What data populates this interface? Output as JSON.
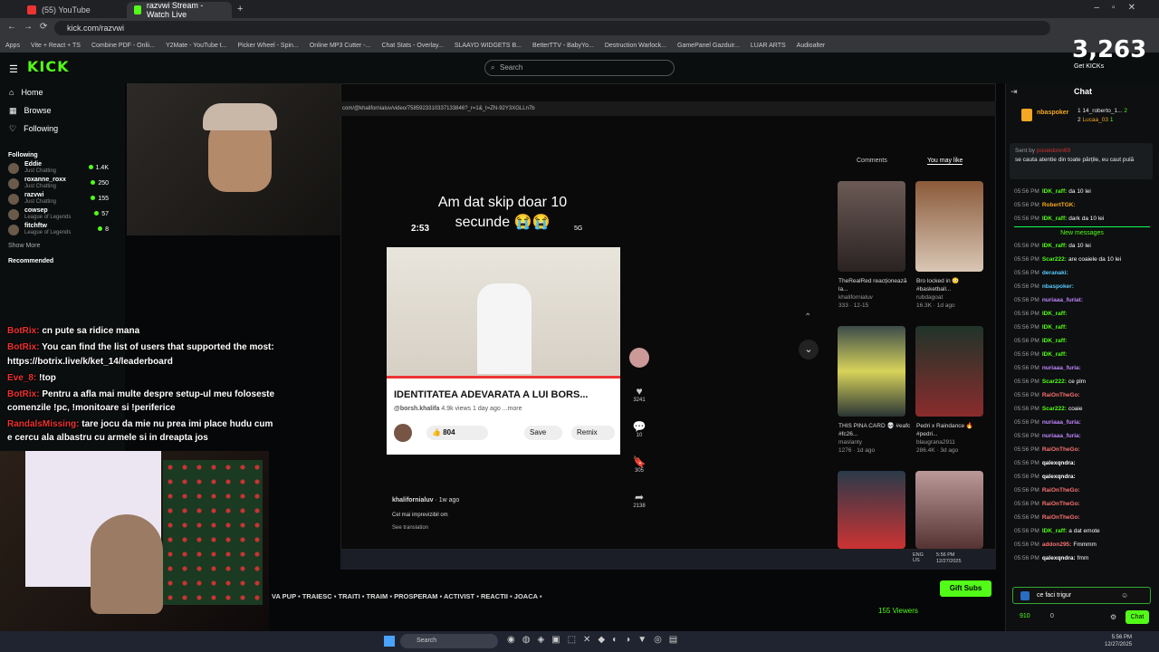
{
  "browser": {
    "tabs": [
      {
        "label": "(55) YouTube"
      },
      {
        "label": "razvwi Stream - Watch Live"
      }
    ],
    "url": "kick.com/razvwi",
    "bookmarks": [
      "Apps",
      "Vite + React + TS",
      "Combine PDF - Onlii...",
      "Y2Mate - YouTube t...",
      "Picker Wheel - Spin...",
      "Online MP3 Cutter -...",
      "Chat Stats - Overlay...",
      "SLAAYD WIDGETS B...",
      "BetterTTV - BabyYo...",
      "Destruction Warlock...",
      "GamePanel Gazduir...",
      "LUAR ARTS",
      "Audioalter"
    ]
  },
  "kick": {
    "logo": "KICK",
    "search_placeholder": "Search",
    "kicks_count": "3,263",
    "get_kicks": "Get KICKs"
  },
  "sidebar": {
    "nav": [
      {
        "label": "Home"
      },
      {
        "label": "Browse"
      },
      {
        "label": "Following"
      }
    ],
    "following_title": "Following",
    "following": [
      {
        "name": "Eddie",
        "cat": "Just Chatting",
        "count": "1.4K"
      },
      {
        "name": "roxanne_roxx",
        "cat": "Just Chatting",
        "count": "250"
      },
      {
        "name": "razvwi",
        "cat": "Just Chatting",
        "count": "155"
      },
      {
        "name": "cowsep",
        "cat": "League of Legends",
        "count": "57"
      },
      {
        "name": "fitchftw",
        "cat": "League of Legends",
        "count": "8"
      }
    ],
    "show_more": "Show More",
    "recommended_title": "Recommended"
  },
  "overlay_chat": [
    {
      "name": "BotRix:",
      "text": "cn pute sa ridice mana"
    },
    {
      "name": "BotRix:",
      "text": "You can find the list of users that supported the most:"
    },
    {
      "name": "",
      "text": "https://botrix.live/k/ket_14/leaderboard"
    },
    {
      "name": "Eve_8:",
      "text": "!top"
    },
    {
      "name": "BotRix:",
      "text": "Pentru a afla mai multe despre setup-ul meu foloseste"
    },
    {
      "name": "",
      "text": "comenzile !pc, !monitoare si !periferice"
    },
    {
      "name": "RandalsMissing:",
      "text": "tare jocu da mie nu prea imi place hudu cum"
    },
    {
      "name": "",
      "text": "e cercu ala albastru cu armele si in dreapta jos"
    }
  ],
  "capture": {
    "url": "com/@khalifornialuv/video/7585923310337133846?_r=1&_t=ZN-92Y3XGLLn7b",
    "video_title": "Am dat skip doar 10 secunde 😭😭",
    "phone_time": "2:53",
    "phone_net": "5G",
    "yt_title": "IDENTITATEA ADEVARATA A LUI BORS...",
    "yt_channel": "@borsh.khalifa",
    "yt_meta": "4.9k views  1 day ago  ...more",
    "likes": "804",
    "save": "Save",
    "remix": "Remix",
    "side_counts": [
      "3241",
      "10",
      "305",
      "2138"
    ],
    "author": "khalifornialuv",
    "author_time": "1w ago",
    "caption": "Cel mai imprevizibil om",
    "see_translation": "See translation",
    "tabs": [
      "Comments",
      "You may like"
    ],
    "recs": [
      {
        "title": "TheRealRed reacționează la...",
        "user": "khalifornialuv",
        "stats": "333 · 12-15"
      },
      {
        "title": "Bro locked in 😳 #basketball...",
        "user": "rubdagoat",
        "stats": "16.3K · 1d ago"
      },
      {
        "title": "THIS PINA CARD 💀 #eafc #fc26...",
        "user": "maslanty",
        "stats": "1276 · 1d ago"
      },
      {
        "title": "Pedri x Raindance 🔥 #pedri...",
        "user": "blaugrana2911",
        "stats": "286.4K · 3d ago"
      }
    ],
    "tray_time": "5:56 PM",
    "tray_date": "12/27/2025",
    "tray_lang": "ENG US"
  },
  "ticker": "VA PUP ▪ TRAIESC ▪ TRAITI ▪ TRAIM ▪ PROSPERAM ▪ ACTIVIST ▪ REACTII ▪ JOACA ▪",
  "gift_subs": "Gift Subs",
  "viewers": "155 Viewers",
  "chat": {
    "title": "Chat",
    "top": [
      {
        "rank": "1",
        "name": "14_roberto_1...",
        "n": "2"
      },
      {
        "rank": "2",
        "name": "Lucaa_03",
        "n": "1"
      }
    ],
    "pinned_by": "Sent by",
    "pinned_name": "nbaspoker",
    "pinned_user": "poseidonn69",
    "pinned_text": "se cauta atentie din toate părțile, eu caut pulă",
    "new_messages": "New messages",
    "messages": [
      {
        "t": "05:56 PM",
        "n": "IDK_raff:",
        "m": "da 10 lei",
        "c": "#53fc18"
      },
      {
        "t": "05:56 PM",
        "n": "RobertTGK:",
        "m": "",
        "c": "#f5a623"
      },
      {
        "t": "05:56 PM",
        "n": "IDK_raff:",
        "m": "dark da 10 lei",
        "c": "#53fc18"
      },
      {
        "t": "05:56 PM",
        "n": "IDK_raff:",
        "m": "da 10 lei",
        "c": "#53fc18"
      },
      {
        "t": "05:56 PM",
        "n": "Scar222:",
        "m": "are coaiele da 10 lei",
        "c": "#53fc18"
      },
      {
        "t": "05:56 PM",
        "n": "deranaki:",
        "m": "",
        "c": "#5ac8fa"
      },
      {
        "t": "05:56 PM",
        "n": "nbaspoker:",
        "m": "",
        "c": "#5ac8fa"
      },
      {
        "t": "05:56 PM",
        "n": "nuriaaa_furiat:",
        "m": "",
        "c": "#c084fc"
      },
      {
        "t": "05:56 PM",
        "n": "IDK_raff:",
        "m": "",
        "c": "#53fc18"
      },
      {
        "t": "05:56 PM",
        "n": "IDK_raff:",
        "m": "",
        "c": "#53fc18"
      },
      {
        "t": "05:56 PM",
        "n": "IDK_raff:",
        "m": "",
        "c": "#53fc18"
      },
      {
        "t": "05:56 PM",
        "n": "IDK_raff:",
        "m": "",
        "c": "#53fc18"
      },
      {
        "t": "05:56 PM",
        "n": "nuriaaa_furia:",
        "m": "",
        "c": "#c084fc"
      },
      {
        "t": "05:56 PM",
        "n": "Scar222:",
        "m": "ce plm",
        "c": "#53fc18"
      },
      {
        "t": "05:56 PM",
        "n": "RaiOnTheGo:",
        "m": "",
        "c": "#f87171"
      },
      {
        "t": "05:56 PM",
        "n": "Scar222:",
        "m": "coaie",
        "c": "#53fc18"
      },
      {
        "t": "05:56 PM",
        "n": "nuriaaa_furia:",
        "m": "",
        "c": "#c084fc"
      },
      {
        "t": "05:56 PM",
        "n": "nuriaaa_furia:",
        "m": "",
        "c": "#c084fc"
      },
      {
        "t": "05:56 PM",
        "n": "RaiOnTheGo:",
        "m": "",
        "c": "#f87171"
      },
      {
        "t": "05:56 PM",
        "n": "qalexqndra:",
        "m": "",
        "c": "#fff"
      },
      {
        "t": "05:56 PM",
        "n": "qalexqndra:",
        "m": "",
        "c": "#fff"
      },
      {
        "t": "05:56 PM",
        "n": "RaiOnTheGo:",
        "m": "",
        "c": "#f87171"
      },
      {
        "t": "05:56 PM",
        "n": "RaiOnTheGo:",
        "m": "",
        "c": "#f87171"
      },
      {
        "t": "05:56 PM",
        "n": "RaiOnTheGo:",
        "m": "",
        "c": "#f87171"
      },
      {
        "t": "05:56 PM",
        "n": "IDK_raff:",
        "m": "a dat emote",
        "c": "#53fc18"
      },
      {
        "t": "05:56 PM",
        "n": "addon295:",
        "m": "Fmmmm",
        "c": "#f87171"
      },
      {
        "t": "05:56 PM",
        "n": "qalexqndra:",
        "m": "fmm",
        "c": "#fff"
      }
    ],
    "input_value": "ce faci trigur",
    "points": "910",
    "chat_button": "Chat",
    "zero": "0"
  },
  "taskbar": {
    "search": "Search",
    "time": "5:56 PM",
    "date": "12/27/2025"
  },
  "colors": {
    "accent": "#53fc18"
  }
}
